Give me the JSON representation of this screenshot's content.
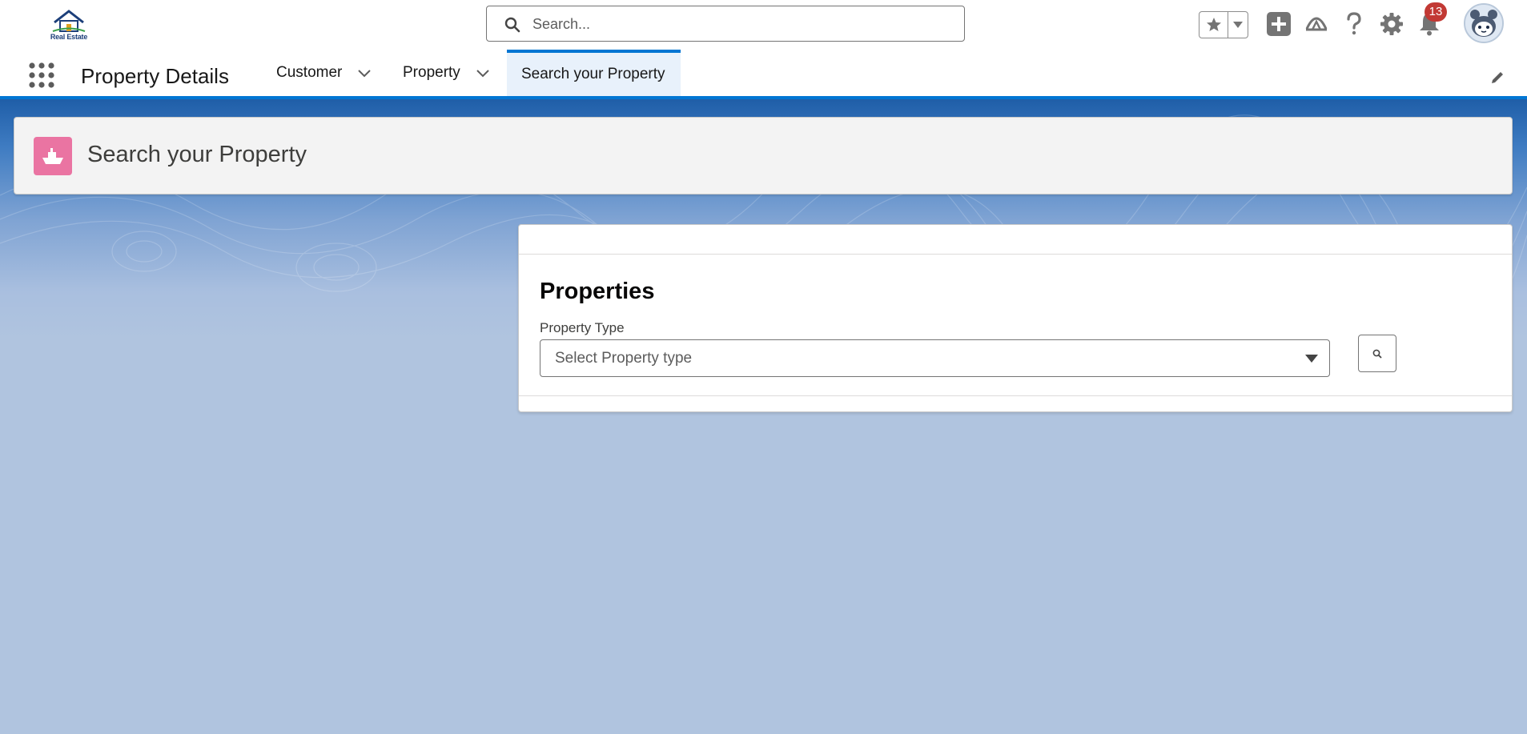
{
  "header": {
    "logo_text": "Real Estate",
    "search_placeholder": "Search...",
    "notification_count": "13"
  },
  "nav": {
    "app_name": "Property Details",
    "items": [
      {
        "label": "Customer",
        "has_menu": true
      },
      {
        "label": "Property",
        "has_menu": true
      },
      {
        "label": "Search your Property",
        "active": true
      }
    ]
  },
  "page": {
    "title": "Search your Property",
    "icon": "ship-icon"
  },
  "card": {
    "title": "Properties",
    "field_label": "Property Type",
    "combobox_placeholder": "Select Property type"
  },
  "colors": {
    "brand": "#0176d3",
    "page_icon": "#ea74a2",
    "badge": "#c23934",
    "background": "#b0c4df"
  }
}
